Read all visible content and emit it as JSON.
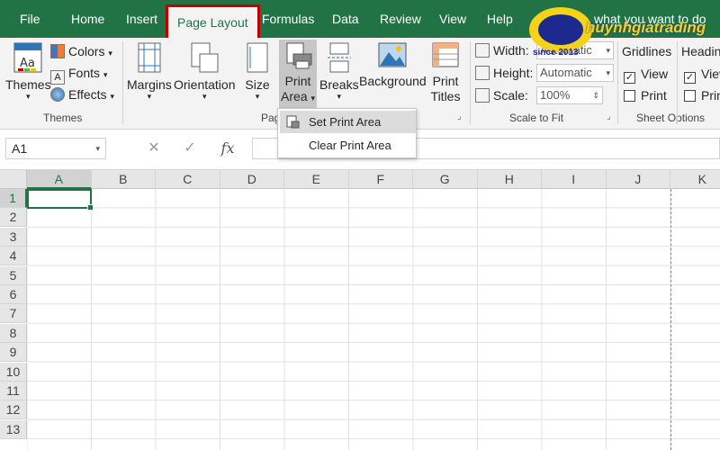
{
  "tabs": [
    "File",
    "Home",
    "Insert",
    "Page Layout",
    "Formulas",
    "Data",
    "Review",
    "View",
    "Help"
  ],
  "tell_me": "what you want to do",
  "watermark": {
    "brand": "huynhgiatrading",
    "since": "since 2013"
  },
  "themes_group": {
    "themes_label": "Themes",
    "colors_label": "Colors",
    "fonts_label": "Fonts",
    "effects_label": "Effects",
    "group_label": "Themes"
  },
  "page_setup": {
    "margins": "Margins",
    "orientation": "Orientation",
    "size": "Size",
    "print_area_1": "Print",
    "print_area_2": "Area",
    "breaks": "Breaks",
    "background": "Background",
    "print_titles_1": "Print",
    "print_titles_2": "Titles",
    "group_label": "Pag"
  },
  "scale_to_fit": {
    "width_label": "Width:",
    "width_value": "Automatic",
    "height_label": "Height:",
    "height_value": "Automatic",
    "scale_label": "Scale:",
    "scale_value": "100%",
    "group_label": "Scale to Fit"
  },
  "sheet_options": {
    "gridlines": "Gridlines",
    "headings": "Headin",
    "view": "View",
    "print": "Print",
    "view2": "Viev",
    "print2": "Prin",
    "group_label": "Sheet Options"
  },
  "print_area_menu": [
    "Set Print Area",
    "Clear Print Area"
  ],
  "formula_bar": {
    "name_box": "A1",
    "cancel": "✕",
    "enter": "✓",
    "fx": "fx"
  },
  "columns": [
    "A",
    "B",
    "C",
    "D",
    "E",
    "F",
    "G",
    "H",
    "I",
    "J",
    "K"
  ],
  "rows": [
    "1",
    "2",
    "3",
    "4",
    "5",
    "6",
    "7",
    "8",
    "9",
    "10",
    "11",
    "12",
    "13"
  ],
  "colors": {
    "excel_green": "#217346",
    "highlight_red": "#c00000"
  }
}
